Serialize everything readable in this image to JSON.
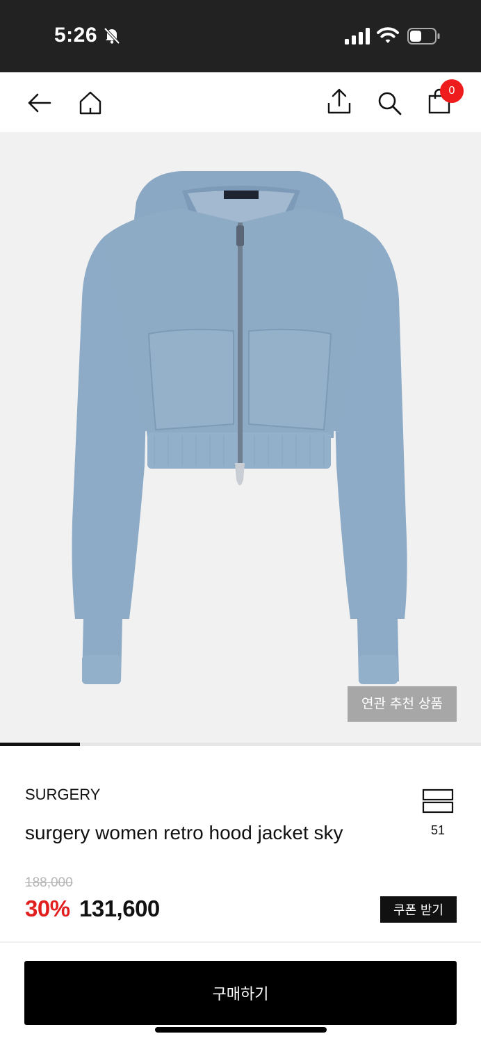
{
  "status_bar": {
    "time": "5:26",
    "icons": [
      "bell-off-icon",
      "signal-icon",
      "wifi-icon",
      "battery-icon"
    ]
  },
  "nav": {
    "icons": [
      "back-arrow-icon",
      "home-icon",
      "share-icon",
      "search-icon",
      "shopping-bag-icon"
    ],
    "cart_count": "0"
  },
  "product": {
    "image_subject": "sky blue cropped zip-up hoodie",
    "related_button_label": "연관 추천 상품",
    "image_progress_fraction": 0.166,
    "brand": "SURGERY",
    "title": "surgery women retro hood jacket sky",
    "like_count": "51",
    "original_price": "188,000",
    "discount_percent": "30%",
    "sale_price": "131,600",
    "coupon_label": "쿠폰 받기"
  },
  "footer": {
    "buy_label": "구매하기"
  },
  "colors": {
    "status_bar_bg": "#222222",
    "badge": "#ee1c1c",
    "discount": "#e21f1f",
    "garment": "#8eabc6"
  }
}
